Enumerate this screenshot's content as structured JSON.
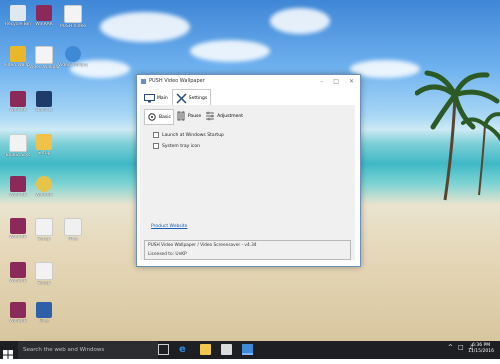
{
  "desktop": {
    "icons": [
      {
        "label": "Recycle Bin",
        "color": "#dfe7ef"
      },
      {
        "label": "WinRAR",
        "color": "#8b2a5a"
      },
      {
        "label": "PUSH Video",
        "color": "#f3f3f3"
      },
      {
        "label": "Video Wallp..",
        "color": "#e8b82a"
      },
      {
        "label": "Video Wallpaper",
        "color": "#f4f4f4"
      },
      {
        "label": "Video Wallpaper",
        "color": "#3e8ad6"
      },
      {
        "label": "WinRAR",
        "color": "#8b2a5a"
      },
      {
        "label": "Davinci",
        "color": "#1e3c6a"
      },
      {
        "label": "BlueStacks",
        "color": "#f2f2f2"
      },
      {
        "label": "Setup",
        "color": "#f0c24a"
      },
      {
        "label": "WinRAR",
        "color": "#8b2a5a"
      },
      {
        "label": "WinRAR",
        "color": "#e8c34a"
      },
      {
        "label": "WinRAR",
        "color": "#8b2a5a"
      },
      {
        "label": "Setup",
        "color": "#f2f2f2"
      },
      {
        "label": "Files",
        "color": "#f0f0f0"
      },
      {
        "label": "WinRAR",
        "color": "#8b2a5a"
      },
      {
        "label": "Setup",
        "color": "#f2f2f2"
      },
      {
        "label": "WinRAR",
        "color": "#8b2a5a"
      },
      {
        "label": "Files",
        "color": "#2e5fa8"
      }
    ]
  },
  "window": {
    "title": "PUSH Video Wallpaper",
    "tabs": [
      {
        "label": "Main",
        "icon": "monitor-icon"
      },
      {
        "label": "Settings",
        "icon": "tools-icon"
      }
    ],
    "subtabs": [
      {
        "label": "Basic",
        "icon": "gear-icon"
      },
      {
        "label": "Pause",
        "icon": "pause-icon"
      },
      {
        "label": "Adjustment",
        "icon": "sliders-icon"
      }
    ],
    "checkboxes": [
      {
        "label": "Launch at Windows Startup",
        "checked": false
      },
      {
        "label": "System tray icon",
        "checked": false
      }
    ],
    "link": "Product Website",
    "footer_line1": "PUSH Video Wallpaper / Video Screensaver - v4.34",
    "footer_line2": "Licensed to: UnKP"
  },
  "taskbar": {
    "search_placeholder": "Search the web and Windows",
    "time": "6:36 PM",
    "date": "11/15/2016"
  },
  "colors": {
    "taskbar_bg": "#1d1f22",
    "window_border": "#6b8fbf",
    "link": "#1a5fb4"
  }
}
